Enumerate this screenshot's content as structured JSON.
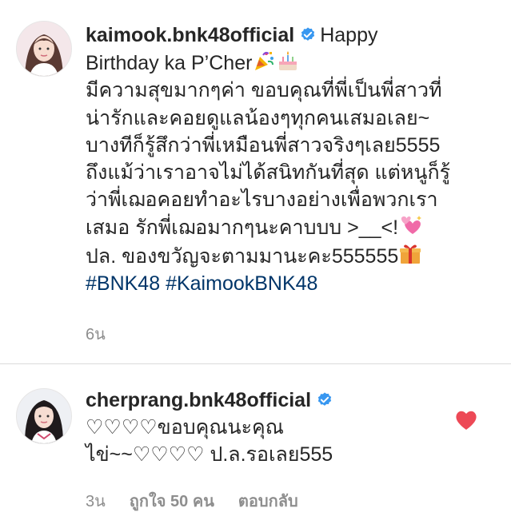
{
  "comments": [
    {
      "username": "kaimook.bnk48official",
      "lines": [
        "Happy",
        "Birthday ka P’Cher",
        "มีความสุขมากๆค่า ขอบคุณที่พี่เป็นพี่สาวที่",
        "น่ารักและคอยดูแลน้องๆทุกคนเสมอเลย~",
        "บางทีก็รู้สึกว่าพี่เหมือนพี่สาวจริงๆเลย5555",
        "ถึงแม้ว่าเราอาจไม่ได้สนิทกันที่สุด แต่หนูก็รู้",
        "ว่าพี่เฌอคอยทำอะไรบางอย่างเพื่อพวกเรา",
        "เสมอ รักพี่เฌอมากๆนะคาบบบ >__<!",
        "ปล. ของขวัญจะตามมานะคะ555555"
      ],
      "hashtags": [
        "#BNK48",
        "#KaimookBNK48"
      ],
      "time": "6น",
      "icons": [
        "verified-badge-icon",
        "party-popper-icon",
        "birthday-cake-icon",
        "sparkling-hearts-icon",
        "gift-icon"
      ]
    },
    {
      "username": "cherprang.bnk48official",
      "lines": [
        "♡♡♡♡ขอบคุณนะคุณ",
        "ไข่~~♡♡♡♡ ป.ล.รอเลย555"
      ],
      "time": "3น",
      "likes": "ถูกใจ 50 คน",
      "reply": "ตอบกลับ",
      "icons": [
        "verified-badge-icon",
        "liked-heart-icon"
      ]
    }
  ],
  "colors": {
    "text": "#262626",
    "secondary": "#8e8e8e",
    "hashtag": "#003569",
    "verified": "#3897f0",
    "liked": "#ed4956",
    "divider": "#dbdbdb"
  }
}
